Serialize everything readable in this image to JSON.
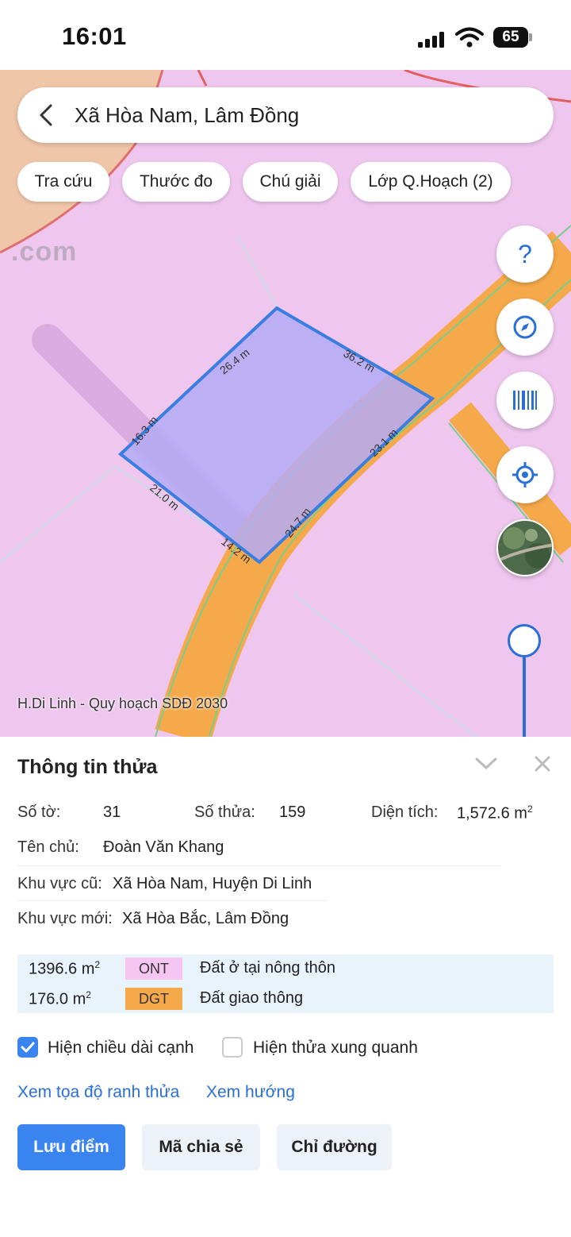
{
  "status": {
    "time": "16:01",
    "battery": "65",
    "icons": [
      "signal-icon",
      "wifi-icon",
      "battery-icon"
    ]
  },
  "search": {
    "text": "Xã Hòa Nam, Lâm Đồng",
    "back_icon": "chevron-left-icon"
  },
  "chips": [
    "Tra cứu",
    "Thước đo",
    "Chú giải",
    "Lớp Q.Hoạch (2)"
  ],
  "map": {
    "watermark": ".com",
    "caption": "H.Di Linh - Quy hoạch SDĐ 2030",
    "edges": [
      "26.4 m",
      "36.2 m",
      "16.3 m",
      "23.1 m",
      "21.0 m",
      "24.7 m",
      "14.2 m"
    ],
    "colors": {
      "land": "#eec6ee",
      "road": "#f5a94a",
      "parcel_fill": "#b9b3f2",
      "parcel_border": "#3a7ee0"
    },
    "controls": [
      "help-icon",
      "compass-icon",
      "barcode-icon",
      "locate-icon",
      "satellite-layer-icon"
    ]
  },
  "panel": {
    "title": "Thông tin thửa",
    "so_to_label": "Số tờ:",
    "so_to": "31",
    "so_thua_label": "Số thửa:",
    "so_thua": "159",
    "dien_tich_label": "Diện tích:",
    "dien_tich": "1,572.6 m",
    "dien_tich_unit_sup": "2",
    "chu_label": "Tên chủ:",
    "chu": "Đoàn Văn Khang",
    "kv_cu_label": "Khu vực cũ:",
    "kv_cu": "Xã Hòa Nam, Huyện Di Linh",
    "kv_moi_label": "Khu vực mới:",
    "kv_moi": "Xã Hòa Bắc, Lâm Đồng",
    "zones": [
      {
        "area": "1396.6 m",
        "sup": "2",
        "code": "ONT",
        "desc": "Đất ở tại nông thôn",
        "color": "#f6c6f2"
      },
      {
        "area": "176.0 m",
        "sup": "2",
        "code": "DGT",
        "desc": "Đất giao thông",
        "color": "#f5a94a"
      }
    ],
    "checkbox_edges": {
      "label": "Hiện chiều dài cạnh",
      "checked": true
    },
    "checkbox_neighbors": {
      "label": "Hiện thửa xung quanh",
      "checked": false
    },
    "links": [
      "Xem tọa độ ranh thửa",
      "Xem hướng"
    ],
    "buttons": [
      "Lưu điểm",
      "Mã chia sẻ",
      "Chỉ đường"
    ],
    "accent": "#3a84f0"
  }
}
